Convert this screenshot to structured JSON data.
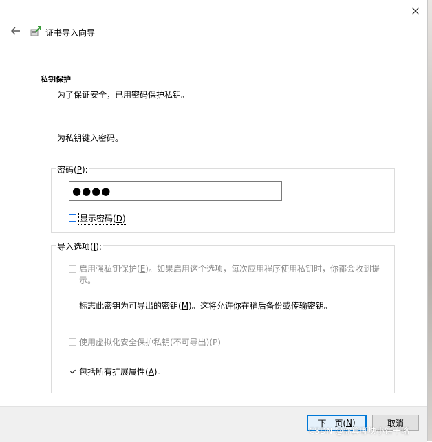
{
  "window": {
    "title": "证书导入向导"
  },
  "section": {
    "title": "私钥保护",
    "subtitle": "为了保证安全，已用密码保护私钥。"
  },
  "prompt": "为私钥键入密码。",
  "password_group": {
    "label_pre": "密码(",
    "label_key": "P",
    "label_post": "):",
    "value": "●●●●",
    "show_password": {
      "pre": "显示密码(",
      "key": "D",
      "post": ")",
      "checked": false
    }
  },
  "import_options": {
    "label_pre": "导入选项(",
    "label_key": "I",
    "label_post": "):",
    "options": [
      {
        "pre": "启用强私钥保护(",
        "key": "E",
        "post": ")。如果启用这个选项，每次应用程序使用私钥时，你都会收到提",
        "line2": "示。",
        "checked": false,
        "enabled": false
      },
      {
        "pre": "标志此密钥为可导出的密钥(",
        "key": "M",
        "post": ")。这将允许你在稍后备份或传输密钥。",
        "checked": false,
        "enabled": true
      },
      {
        "pre": "使用虚拟化安全保护私钥(不可导出)(",
        "key": "P",
        "post": ")",
        "checked": false,
        "enabled": false
      },
      {
        "pre": "包括所有扩展属性(",
        "key": "A",
        "post": ")。",
        "checked": true,
        "enabled": true
      }
    ]
  },
  "buttons": {
    "next": {
      "pre": "下一页(",
      "key": "N",
      "post": ")"
    },
    "cancel": "取消"
  },
  "watermark": "CSDN @你算哪块小饼干略",
  "icons": {
    "close": "close-icon",
    "back": "back-arrow-icon",
    "wizard": "certificate-wizard-icon"
  }
}
